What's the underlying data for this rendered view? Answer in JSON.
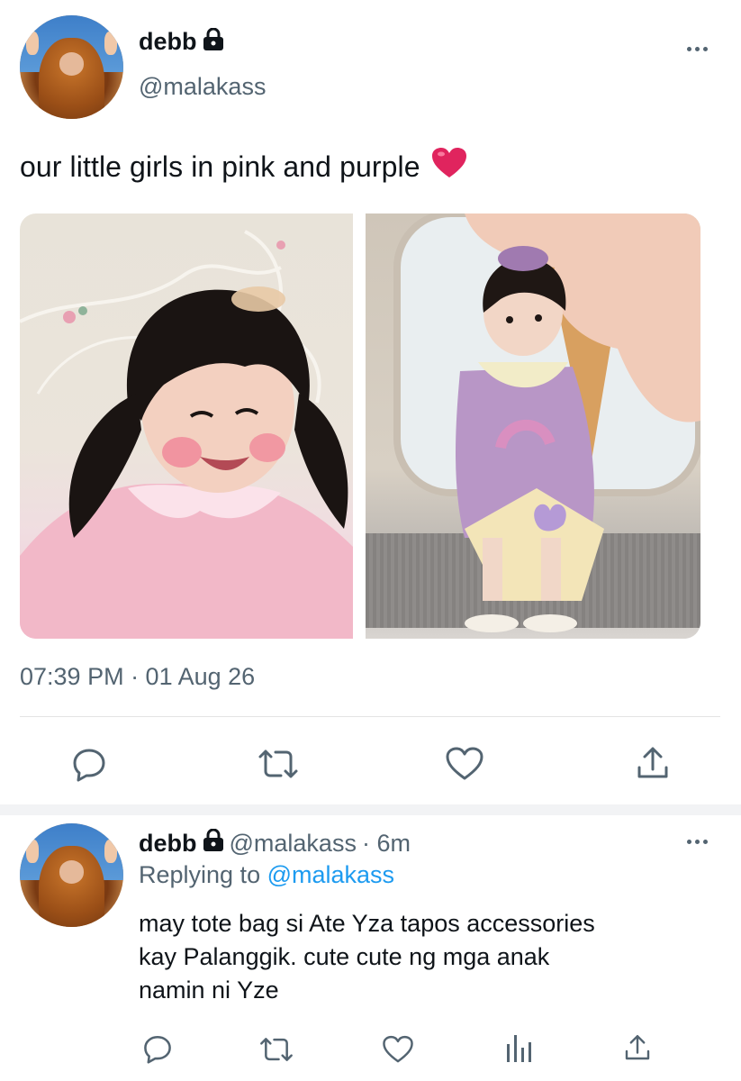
{
  "tweet": {
    "display_name": "debb",
    "handle": "@malakass",
    "text": "our little girls in pink and purple",
    "emoji": "❤️",
    "timestamp": "07:39 PM · 01 Aug 26",
    "avatar_icon": "avatar-photo",
    "more_icon": "more-dots-icon",
    "actions": [
      "reply-icon",
      "retweet-icon",
      "like-icon",
      "share-icon"
    ]
  },
  "reply": {
    "display_name": "debb",
    "handle": "@malakass",
    "time": "· 6m",
    "replying_prefix": "Replying to",
    "replying_to": "@malakass",
    "lines": [
      "may tote bag si Ate Yza tapos accessories",
      "kay Palanggik. cute cute ng mga anak",
      "namin ni Yze"
    ],
    "actions": [
      "reply-icon",
      "retweet-icon",
      "like-icon",
      "analytics-icon",
      "share-icon"
    ]
  },
  "colors": {
    "text": "#0f1419",
    "secondary": "#536471",
    "link": "#1d9bf0",
    "heart": "#e0245e"
  }
}
